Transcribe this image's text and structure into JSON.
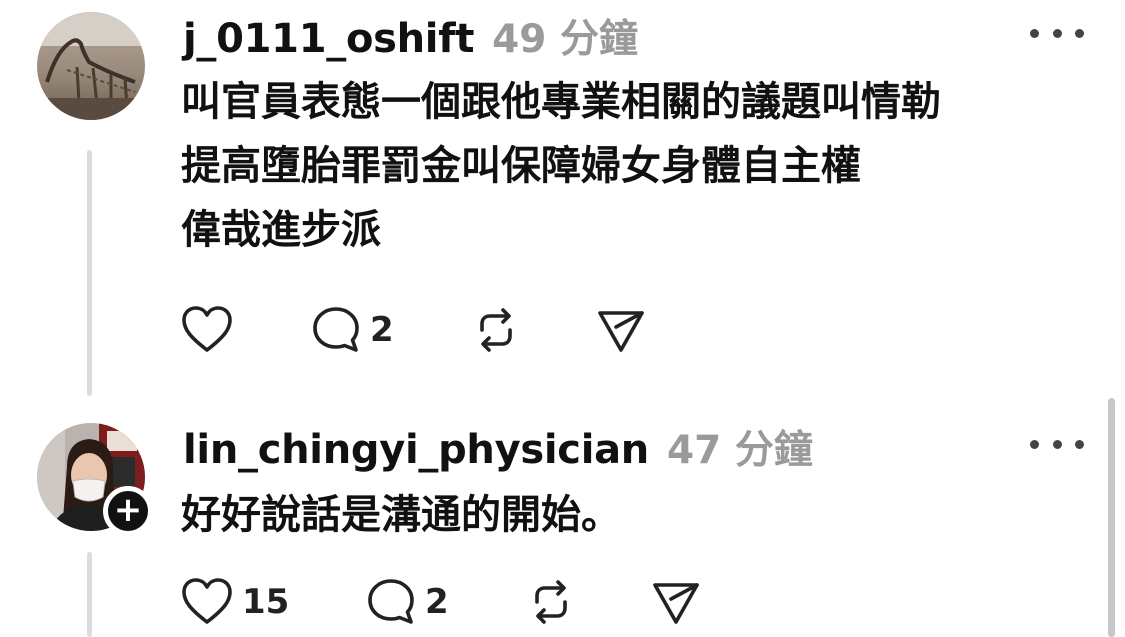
{
  "posts": [
    {
      "username": "j_0111_oshift",
      "timestamp": "49 分鐘",
      "lines": [
        "叫官員表態一個跟他專業相關的議題叫情勒",
        "提高墮胎罪罰金叫保障婦女身體自主權",
        "偉哉進步派"
      ],
      "likes": "",
      "replies": "2",
      "avatar_icon": "dinosaur-skeleton-photo",
      "following": true
    },
    {
      "username": "lin_chingyi_physician",
      "timestamp": "47 分鐘",
      "lines": [
        "好好說話是溝通的開始。"
      ],
      "likes": "15",
      "replies": "2",
      "avatar_icon": "woman-with-mask-photo",
      "follow_badge": "+",
      "following": false
    }
  ],
  "icons": {
    "like": "heart-icon",
    "reply": "comment-bubble-icon",
    "repost": "repost-arrows-icon",
    "share": "send-paper-plane-icon",
    "more": "more-dots-icon"
  },
  "colors": {
    "text": "#111111",
    "muted": "#9a9a9a",
    "thread_line": "#dcdcdc",
    "background": "#ffffff"
  }
}
